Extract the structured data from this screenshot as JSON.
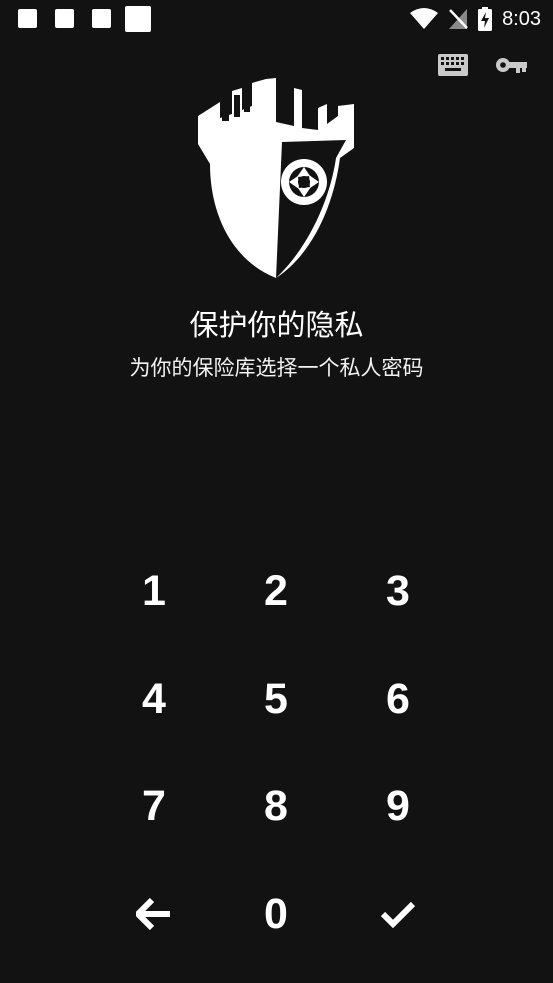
{
  "status_bar": {
    "time": "8:03",
    "notification_icons": [
      "notification-square-icon",
      "notification-square-icon",
      "notification-square-icon",
      "notification-square-icon"
    ],
    "right_icons": [
      "wifi-icon",
      "no-signal-icon",
      "battery-charging-icon"
    ]
  },
  "toolbar": {
    "icons": [
      "keyboard-icon",
      "key-icon"
    ]
  },
  "logo": {
    "icon": "castle-shield-aperture-logo"
  },
  "header": {
    "title": "保护你的隐私",
    "subtitle": "为你的保险库选择一个私人密码"
  },
  "keypad": {
    "keys": [
      "1",
      "2",
      "3",
      "4",
      "5",
      "6",
      "7",
      "8",
      "9"
    ],
    "zero": "0",
    "back_icon": "arrow-left-icon",
    "confirm_icon": "check-icon"
  },
  "colors": {
    "background": "#121212",
    "foreground": "#ffffff"
  }
}
